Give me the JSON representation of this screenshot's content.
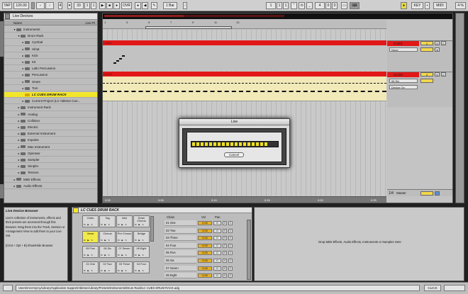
{
  "app": {
    "dialog_title": "Live"
  },
  "topbar": {
    "tap": "TAP",
    "tempo": "120.00",
    "position": [
      "33",
      "1",
      "1"
    ],
    "ovr": "OVR",
    "quantize": "1 Bar",
    "loop_start": [
      "1",
      "1",
      "1"
    ],
    "loop_len": [
      "4",
      "0",
      "0"
    ],
    "key": "KEY",
    "midi": "MIDI",
    "cpu": "4 %"
  },
  "browser": {
    "title": "Live Devices",
    "col_name": "Name",
    "col_right": "Live Pi",
    "items": [
      {
        "label": "Instruments",
        "depth": 0,
        "open": true
      },
      {
        "label": "Drum Rack",
        "depth": 1,
        "open": true
      },
      {
        "label": "Cymbal",
        "depth": 2
      },
      {
        "label": "Hihat",
        "depth": 2
      },
      {
        "label": "Kick",
        "depth": 2
      },
      {
        "label": "Kit",
        "depth": 2
      },
      {
        "label": "Latin Percussion",
        "depth": 2
      },
      {
        "label": "Percussion",
        "depth": 2
      },
      {
        "label": "Snare",
        "depth": 2
      },
      {
        "label": "Tom",
        "depth": 2
      },
      {
        "label": "LC CUES DRUM RACK",
        "depth": 2,
        "selected": true
      },
      {
        "label": "Current Project (LC Ableton Cue...",
        "depth": 2
      },
      {
        "label": "Instrument Rack",
        "depth": 1
      },
      {
        "label": "Analog",
        "depth": 1
      },
      {
        "label": "Collision",
        "depth": 1
      },
      {
        "label": "Electric",
        "depth": 1
      },
      {
        "label": "External Instrument",
        "depth": 1
      },
      {
        "label": "Impulse",
        "depth": 1
      },
      {
        "label": "Max Instrument",
        "depth": 1
      },
      {
        "label": "Operator",
        "depth": 1
      },
      {
        "label": "Sampler",
        "depth": 1
      },
      {
        "label": "Simpler",
        "depth": 1
      },
      {
        "label": "Tension",
        "depth": 1
      },
      {
        "label": "MIDI Effects",
        "depth": 0
      },
      {
        "label": "Audio Effects",
        "depth": 0
      }
    ]
  },
  "arrangement": {
    "ruler": [
      "1",
      "3",
      "5",
      "7",
      "9",
      "11",
      "13"
    ],
    "times": [
      "0:00",
      "0:05",
      "0:10",
      "0:15",
      "0:20",
      "0:25"
    ],
    "fraction": "1/4",
    "master_label": "Master",
    "track1": {
      "name": "CUES",
      "number": "1",
      "dd1": "None",
      "clip": "CUES"
    },
    "track2": {
      "name": "CLICK",
      "number": "2",
      "dd1": "06 Six",
      "dd2": "Device On",
      "clip": "CLICK"
    },
    "btn_s": "S",
    "btn_c": "C"
  },
  "dialog": {
    "cancel": "Cancel",
    "segments": 18
  },
  "info": {
    "title": "Live Device Browser",
    "body": "Live's collection of instruments, effects and their presets are accessed through this Browser. Drag them into the Track, Session or Arrangement View to add them to your Live Set.",
    "hint": "[Cmd + Opt + B] Show/Hide Browser"
  },
  "rack": {
    "title": "LC CUES DRUM RACK",
    "pads": [
      [
        "Outro",
        "Tag",
        "Intro",
        "Down Chorus"
      ],
      [
        "Verse",
        "Chorus",
        "Pre Chorus",
        "Bridge"
      ],
      [
        "05 Five",
        "06 Six",
        "07 Seven",
        "08 Eight"
      ],
      [
        "01 Onk",
        "02 Two",
        "03 Three",
        "04 Four"
      ]
    ],
    "pad_buttons": "M ▶ S",
    "chain_header": "Chain",
    "vol_header": "Vol",
    "pan_header": "Pan",
    "chains": [
      {
        "name": "01 One",
        "vol": "0.00",
        "pan": "C"
      },
      {
        "name": "02 Two",
        "vol": "0.00",
        "pan": "C"
      },
      {
        "name": "03 Three",
        "vol": "0.00",
        "pan": "C"
      },
      {
        "name": "04 Four",
        "vol": "0.00",
        "pan": "C"
      },
      {
        "name": "05 Five",
        "vol": "0.00",
        "pan": "C"
      },
      {
        "name": "06 Six",
        "vol": "0.00",
        "pan": "C"
      },
      {
        "name": "07 Seven",
        "vol": "0.00",
        "pan": "C"
      },
      {
        "name": "08 Eight",
        "vol": "0.00",
        "pan": "C"
      }
    ]
  },
  "drop": {
    "text": "Drop MIDI Effects, Audio Effects, Instruments or Samples Here"
  },
  "status": {
    "path": "Users/mrcrmyrcy/Library/Application Support/Ableton/Library/Presets/Instruments/Drum Rack/LC CUES DRUM RACK.adg",
    "right": "CLICK"
  },
  "colors": {
    "clip_red": "#e21818",
    "selection_yellow": "#f2e62a",
    "progress_yellow": "#f0e020",
    "volume_orange": "#e6b026"
  }
}
